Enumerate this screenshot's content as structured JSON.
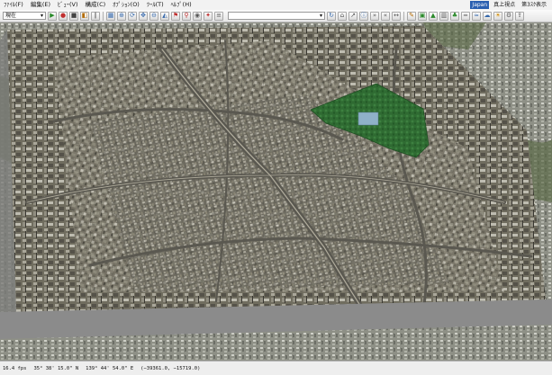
{
  "menu": [
    {
      "label": "ﾌｧｲﾙ(F)"
    },
    {
      "label": "編集(E)"
    },
    {
      "label": "ﾋﾞｭｰ(V)"
    },
    {
      "label": "構成(C)"
    },
    {
      "label": "ｵﾌﾟｼｮﾝ(O)"
    },
    {
      "label": "ﾂｰﾙ(T)"
    },
    {
      "label": "ﾍﾙﾌﾟ(H)"
    }
  ],
  "menu_right": {
    "language": "Japan",
    "view_mode": "真上視点",
    "display": "第3ｽｸ表示"
  },
  "toolbar": {
    "time_select": "現在"
  },
  "status": {
    "fps": "16.4 fps",
    "latitude": "35° 38' 15.0\" N",
    "longitude": "139° 44' 54.0\" E",
    "coords": "(−39361.0, −15719.0)"
  },
  "colors": {
    "park": "#2f6b32",
    "pond": "#8fb1c9",
    "gray_band": "#8b8b8b"
  }
}
